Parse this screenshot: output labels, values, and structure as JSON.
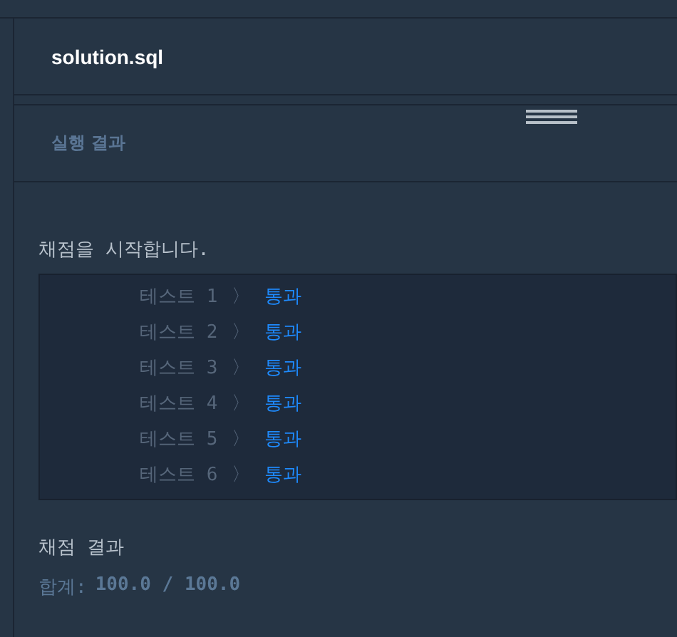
{
  "editor": {
    "filename": "solution.sql"
  },
  "output_panel": {
    "title": "실행 결과",
    "intro": "채점을 시작합니다.",
    "tests": [
      {
        "label": "테스트 1",
        "arrow": "〉",
        "result": "통과"
      },
      {
        "label": "테스트 2",
        "arrow": "〉",
        "result": "통과"
      },
      {
        "label": "테스트 3",
        "arrow": "〉",
        "result": "통과"
      },
      {
        "label": "테스트 4",
        "arrow": "〉",
        "result": "통과"
      },
      {
        "label": "테스트 5",
        "arrow": "〉",
        "result": "통과"
      },
      {
        "label": "테스트 6",
        "arrow": "〉",
        "result": "통과"
      }
    ],
    "summary_title": "채점 결과",
    "total_label": "합계:",
    "total_value": "100.0 / 100.0"
  }
}
